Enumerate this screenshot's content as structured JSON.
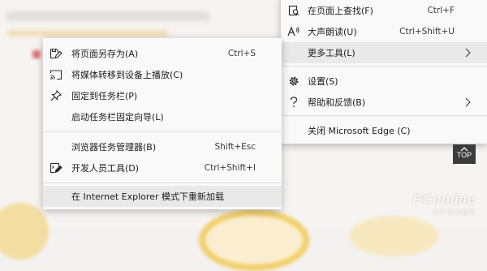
{
  "main_menu": {
    "items": [
      {
        "label": "在页面上查找(F)",
        "shortcut": "Ctrl+F",
        "icon": "find-icon"
      },
      {
        "label": "大声朗读(U)",
        "shortcut": "Ctrl+Shift+U",
        "icon": "read-aloud-icon"
      },
      {
        "label": "更多工具(L)",
        "icon": "",
        "has_submenu": true
      },
      {
        "label": "设置(S)",
        "icon": "gear-icon"
      },
      {
        "label": "帮助和反馈(B)",
        "icon": "help-icon",
        "has_submenu": true
      },
      {
        "label": "关闭 Microsoft Edge (C)",
        "icon": ""
      }
    ]
  },
  "sub_menu": {
    "items": [
      {
        "label": "将页面另存为(A)",
        "shortcut": "Ctrl+S",
        "icon": "save-as-icon"
      },
      {
        "label": "将媒体转移到设备上播放(C)",
        "icon": "cast-icon"
      },
      {
        "label": "固定到任务栏(P)",
        "icon": "pin-icon"
      },
      {
        "label": "启动任务栏固定向导(L)",
        "icon": ""
      },
      {
        "label": "浏览器任务管理器(B)",
        "shortcut": "Shift+Esc",
        "icon": ""
      },
      {
        "label": "开发人员工具(D)",
        "shortcut": "Ctrl+Shift+I",
        "icon": "dev-tools-icon"
      },
      {
        "label": "在 Internet Explorer 模式下重新加载",
        "icon": ""
      }
    ]
  },
  "top_button": {
    "label": "TOP",
    "icon": "caret-up-icon"
  },
  "watermark": {
    "main": "PConline",
    "sub": "太平洋电脑网"
  }
}
